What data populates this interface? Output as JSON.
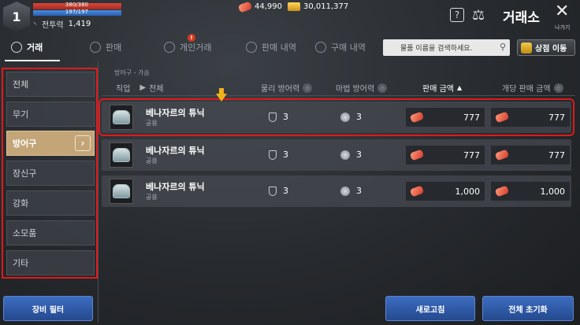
{
  "player": {
    "level": "1",
    "hp_text": "380/380",
    "mp_text": "197/197",
    "hp_fraction": 1.0,
    "mp_fraction": 1.0,
    "power_label": "전투력",
    "power_value": "1,419"
  },
  "currency": {
    "gems": "44,990",
    "gold": "30,011,377"
  },
  "header": {
    "title": "거래소",
    "close_label": "나가기",
    "help_glyph": "?"
  },
  "tabs": [
    {
      "label": "거래",
      "active": true
    },
    {
      "label": "판매",
      "active": false
    },
    {
      "label": "개인거래",
      "active": false,
      "alert": "!"
    },
    {
      "label": "판매 내역",
      "active": false
    },
    {
      "label": "구매 내역",
      "active": false
    }
  ],
  "search": {
    "placeholder": "물품 이름을 검색하세요."
  },
  "shop_button": {
    "label": "상점 이동"
  },
  "sidebar": {
    "items": [
      {
        "label": "전체"
      },
      {
        "label": "무기"
      },
      {
        "label": "방어구",
        "active": true
      },
      {
        "label": "장신구"
      },
      {
        "label": "강화"
      },
      {
        "label": "소모품"
      },
      {
        "label": "기타"
      }
    ],
    "filter_button": "장비 필터"
  },
  "list": {
    "breadcrumb": "방어구 - 가슴",
    "headers": {
      "job": "직업",
      "job_value": "전체",
      "phys_def": "물리 방어력",
      "mag_def": "마법 방어력",
      "price": "판매 금액",
      "unit_price": "개당 판매 금액"
    },
    "rows": [
      {
        "name": "베나자르의 튜닉",
        "class": "공용",
        "phys": "3",
        "mag": "3",
        "price": "777",
        "unit_price": "777"
      },
      {
        "name": "베나자르의 튜닉",
        "class": "공용",
        "phys": "3",
        "mag": "3",
        "price": "777",
        "unit_price": "777"
      },
      {
        "name": "베나자르의 튜닉",
        "class": "공용",
        "phys": "3",
        "mag": "3",
        "price": "1,000",
        "unit_price": "1,000"
      }
    ]
  },
  "buttons": {
    "refresh": "새로고침",
    "reset_all": "전체 초기화"
  },
  "colors": {
    "accent_gold": "#c3a577",
    "button_blue": "#2f5aa6",
    "highlight_red": "#e01a1a"
  }
}
